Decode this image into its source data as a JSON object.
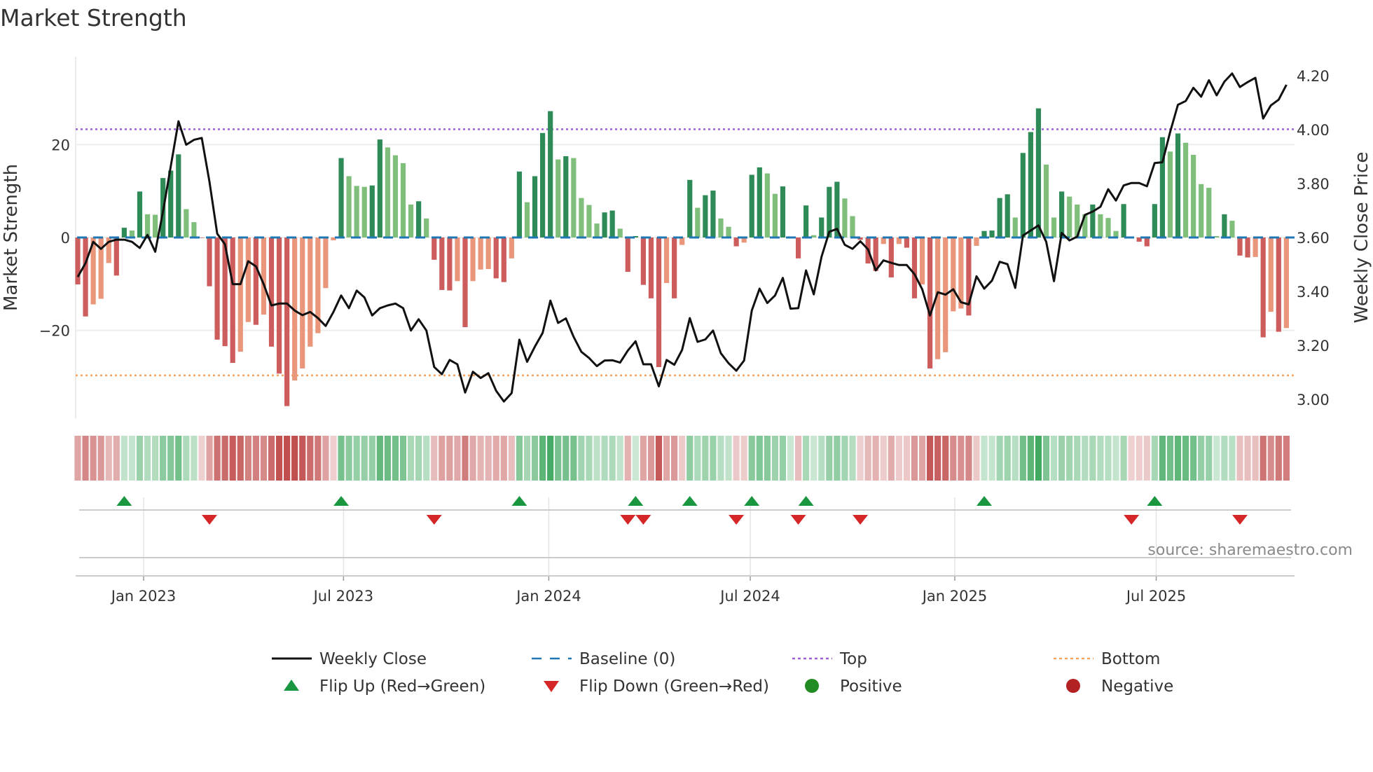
{
  "title": "Market Strength",
  "source": "source: sharemaestro.com",
  "chart_data": {
    "type": "bar",
    "title": "Market Strength",
    "ylabel": "Market Strength",
    "y2label": "Weekly Close Price",
    "ylim": [
      -37,
      36
    ],
    "y2lim": [
      2.95,
      4.3
    ],
    "yticks": [
      {
        "v": 20,
        "label": "20"
      },
      {
        "v": 0,
        "label": "0"
      },
      {
        "v": -20,
        "label": "−20"
      }
    ],
    "y2ticks": [
      {
        "v": 4.2,
        "label": "4.20"
      },
      {
        "v": 4.0,
        "label": "4.00"
      },
      {
        "v": 3.8,
        "label": "3.80"
      },
      {
        "v": 3.6,
        "label": "3.60"
      },
      {
        "v": 3.4,
        "label": "3.40"
      },
      {
        "v": 3.2,
        "label": "3.20"
      },
      {
        "v": 3.0,
        "label": "3.00"
      }
    ],
    "xticks": [
      {
        "week": 8.5,
        "label": "Jan 2023"
      },
      {
        "week": 34.3,
        "label": "Jul 2023"
      },
      {
        "week": 60.8,
        "label": "Jan 2024"
      },
      {
        "week": 86.8,
        "label": "Jul 2024"
      },
      {
        "week": 113.2,
        "label": "Jan 2025"
      },
      {
        "week": 139.2,
        "label": "Jul 2025"
      }
    ],
    "top": 23.3,
    "bottom": -29.7,
    "baseline": 0,
    "strength": [
      -10.1,
      -17,
      -14.4,
      -13.2,
      -5.5,
      -8.2,
      2.1,
      1.5,
      9.9,
      5.0,
      4.9,
      12.8,
      14.4,
      17.9,
      6.1,
      3.3,
      -0.1,
      -10.5,
      -22,
      -23.4,
      -27,
      -24.6,
      -18.2,
      -18.8,
      -16.6,
      -23.5,
      -29.3,
      -36.3,
      -30.8,
      -28.2,
      -23.5,
      -20.6,
      -10.9,
      -0.6,
      17.1,
      13.2,
      11.1,
      10.9,
      11.2,
      21.1,
      19.4,
      17.7,
      16,
      7.1,
      7.8,
      4.1,
      -4.8,
      -11.3,
      -11.4,
      -9.4,
      -19.3,
      -9.4,
      -6.9,
      -6.8,
      -8.8,
      -9.6,
      -4.5,
      14.2,
      7.6,
      13.2,
      22.5,
      27.2,
      16.8,
      17.5,
      17.1,
      8.5,
      7.0,
      3.0,
      5.4,
      5.8,
      1.9,
      -7.4,
      0.3,
      -10.2,
      -13.1,
      -27.9,
      -9.8,
      -13.1,
      -1.6,
      12.4,
      6.4,
      9.1,
      10.1,
      4.1,
      2.3,
      -1.9,
      -1.1,
      13.5,
      15.1,
      13.8,
      9.4,
      11,
      0.2,
      -4.5,
      6.9,
      0.5,
      4.3,
      10.9,
      12,
      8.4,
      4.6,
      -0.5,
      -5.6,
      -7.2,
      -1.4,
      -8.6,
      -1.4,
      -2.2,
      -13.1,
      -10.1,
      -28.2,
      -26.2,
      -24.7,
      -15.9,
      -15.3,
      -16.8,
      -1.8,
      1.4,
      1.5,
      8.5,
      9.3,
      4.3,
      18.2,
      22.7,
      27.8,
      15.7,
      4.3,
      9.9,
      8.8,
      7.1,
      5.0,
      7.1,
      5.0,
      4.2,
      1.4,
      7.2,
      -0.1,
      -0.9,
      -1.9,
      7.2,
      21.6,
      18.5,
      22.4,
      20.4,
      17.8,
      11.5,
      10.7,
      0.3,
      5.0,
      3.6,
      -3.9,
      -4.3,
      -4.2,
      -21.5,
      -16,
      -20.3,
      -19.5
    ],
    "close": [
      3.454,
      3.505,
      3.584,
      3.558,
      3.584,
      3.592,
      3.592,
      3.584,
      3.561,
      3.61,
      3.547,
      3.696,
      3.863,
      4.031,
      3.944,
      3.962,
      3.969,
      3.807,
      3.614,
      3.575,
      3.427,
      3.427,
      3.512,
      3.493,
      3.427,
      3.348,
      3.355,
      3.355,
      3.329,
      3.312,
      3.324,
      3.301,
      3.272,
      3.324,
      3.385,
      3.338,
      3.403,
      3.378,
      3.311,
      3.338,
      3.348,
      3.355,
      3.338,
      3.255,
      3.297,
      3.255,
      3.12,
      3.093,
      3.146,
      3.13,
      3.025,
      3.102,
      3.079,
      3.097,
      3.032,
      2.992,
      3.023,
      3.221,
      3.139,
      3.195,
      3.246,
      3.366,
      3.283,
      3.3,
      3.232,
      3.176,
      3.153,
      3.123,
      3.144,
      3.145,
      3.136,
      3.181,
      3.215,
      3.13,
      3.13,
      3.048,
      3.146,
      3.128,
      3.183,
      3.301,
      3.213,
      3.222,
      3.255,
      3.171,
      3.134,
      3.106,
      3.144,
      3.329,
      3.41,
      3.357,
      3.385,
      3.45,
      3.336,
      3.338,
      3.478,
      3.389,
      3.529,
      3.621,
      3.632,
      3.573,
      3.558,
      3.586,
      3.556,
      3.478,
      3.515,
      3.506,
      3.498,
      3.498,
      3.464,
      3.408,
      3.311,
      3.397,
      3.388,
      3.408,
      3.36,
      3.352,
      3.456,
      3.41,
      3.44,
      3.51,
      3.501,
      3.413,
      3.607,
      3.626,
      3.645,
      3.584,
      3.438,
      3.617,
      3.589,
      3.603,
      3.684,
      3.696,
      3.714,
      3.779,
      3.737,
      3.793,
      3.802,
      3.802,
      3.79,
      3.876,
      3.879,
      3.992,
      4.092,
      4.106,
      4.155,
      4.122,
      4.183,
      4.127,
      4.178,
      4.208,
      4.158,
      4.176,
      4.192,
      4.041,
      4.09,
      4.111,
      4.166
    ],
    "flip_up_weeks": [
      6,
      34,
      57,
      72,
      79,
      87,
      94,
      117,
      139
    ],
    "flip_down_weeks": [
      17,
      46,
      71,
      73,
      85,
      93,
      101,
      136,
      150
    ],
    "legend_position": "bottom",
    "legend": [
      {
        "key": "close",
        "label": "Weekly Close"
      },
      {
        "key": "baseline",
        "label": "Baseline (0)"
      },
      {
        "key": "top",
        "label": "Top"
      },
      {
        "key": "bottom",
        "label": "Bottom"
      },
      {
        "key": "flipup",
        "label": "Flip Up (Red→Green)"
      },
      {
        "key": "flipdown",
        "label": "Flip Down (Green→Red)"
      },
      {
        "key": "positive",
        "label": "Positive"
      },
      {
        "key": "negative",
        "label": "Negative"
      }
    ],
    "colors": {
      "pos_strong": "#2e8b57",
      "pos_weak": "#7fbf7b",
      "neg_strong": "#cd5c5c",
      "neg_weak": "#e9967a",
      "close": "#111111",
      "baseline": "#1f77b4",
      "top": "#9b5fd6",
      "bottom": "#f4a460",
      "flipup": "#1a9641",
      "flipdown": "#d62728",
      "positive": "#228b22",
      "negative": "#b22222"
    }
  }
}
